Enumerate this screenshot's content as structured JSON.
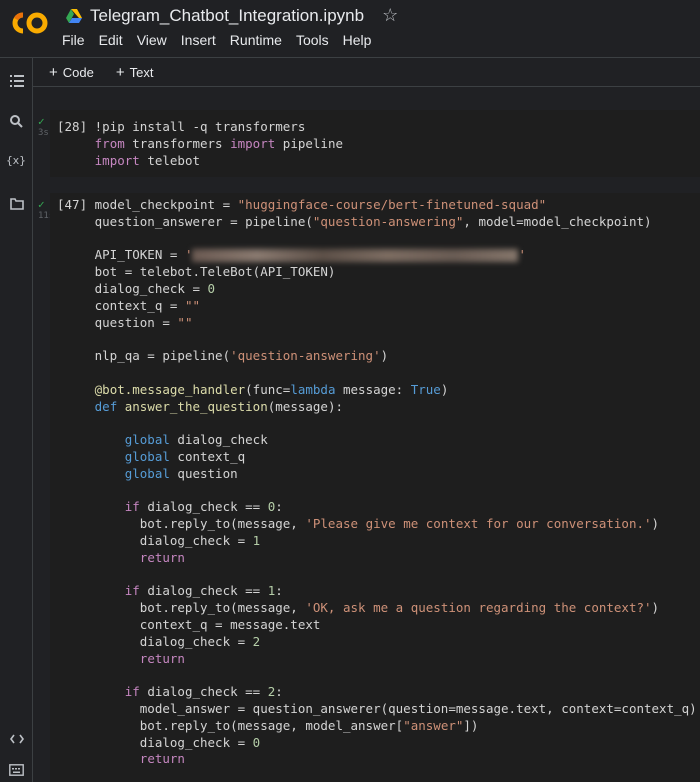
{
  "header": {
    "logo_text": "CO",
    "notebook_title": "Telegram_Chatbot_Integration.ipynb",
    "menu": [
      "File",
      "Edit",
      "View",
      "Insert",
      "Runtime",
      "Tools",
      "Help"
    ]
  },
  "toolbar": {
    "add_code_label": "Code",
    "add_text_label": "Text"
  },
  "sidebar": {
    "icons": [
      "toc-icon",
      "search-icon",
      "variables-icon",
      "files-icon",
      "code-snippets-icon",
      "terminal-icon"
    ],
    "variables_glyph": "{x}"
  },
  "cells": [
    {
      "exec_count": "[28]",
      "duration": "3s",
      "status": "success"
    },
    {
      "exec_count": "[47]",
      "duration": "11s",
      "status": "success"
    }
  ],
  "colors": {
    "background": "#202124",
    "cell_background": "#1e1e1e",
    "success": "#34a853",
    "keyword": "#c586c0",
    "builtin": "#569cd6",
    "string": "#ce9178"
  }
}
